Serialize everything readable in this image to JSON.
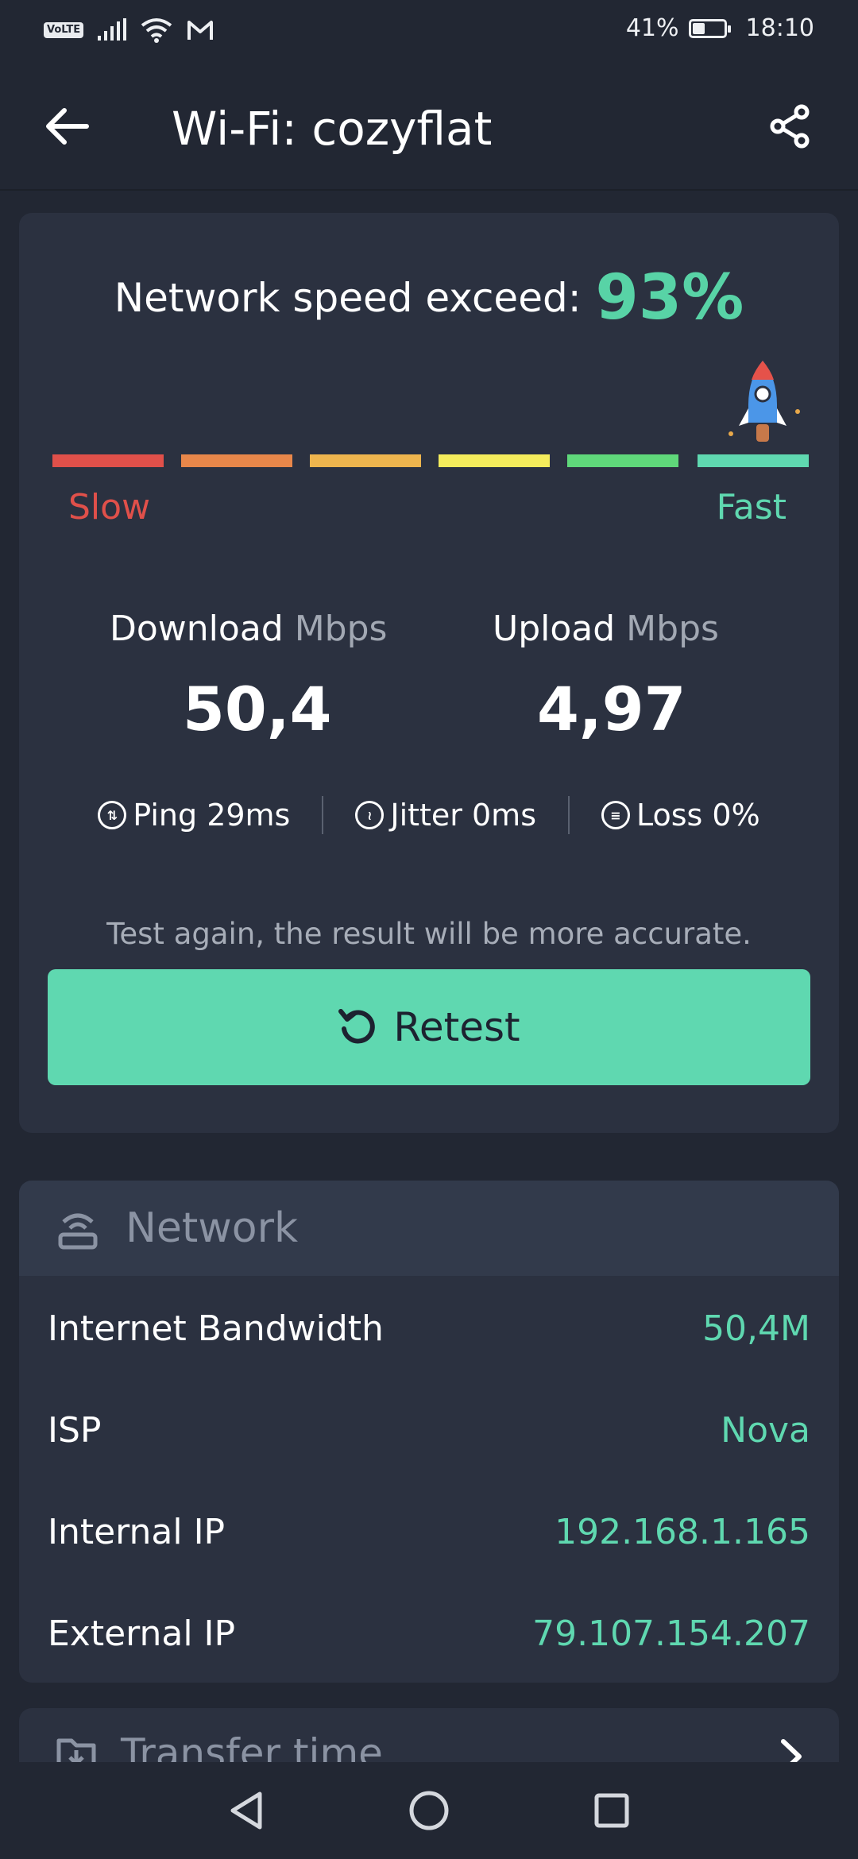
{
  "status_bar": {
    "volte": "VoLTE",
    "battery_text": "41%",
    "battery_level": 0.41,
    "time": "18:10",
    "icons": [
      "signal-icon",
      "wifi-icon",
      "gmail-icon",
      "battery-icon"
    ]
  },
  "header": {
    "title": "Wi-Fi: cozyflat",
    "icons": [
      "back-arrow-icon",
      "share-icon"
    ]
  },
  "speed": {
    "exceed_label": "Network speed exceed:",
    "exceed_value": "93%",
    "scale_colors": [
      "#e0504a",
      "#e8874a",
      "#eeb54e",
      "#f4ec5c",
      "#5fd87a",
      "#5fd8b0"
    ],
    "slow_label": "Slow",
    "fast_label": "Fast",
    "download_label": "Download",
    "download_unit": "Mbps",
    "download_value": "50,4",
    "upload_label": "Upload",
    "upload_unit": "Mbps",
    "upload_value": "4,97",
    "ping": "Ping 29ms",
    "jitter": "Jitter 0ms",
    "loss": "Loss 0%",
    "hint": "Test again, the result will be more accurate.",
    "retest_label": "Retest"
  },
  "network": {
    "title": "Network",
    "rows": [
      {
        "key": "Internet Bandwidth",
        "value": "50,4M"
      },
      {
        "key": "ISP",
        "value": "Nova"
      },
      {
        "key": "Internal IP",
        "value": "192.168.1.165"
      },
      {
        "key": "External IP",
        "value": "79.107.154.207"
      }
    ]
  },
  "transfer": {
    "title": "Transfer time"
  },
  "colors": {
    "accent": "#5fd8b0",
    "background": "#222733",
    "card": "#2b3140"
  }
}
